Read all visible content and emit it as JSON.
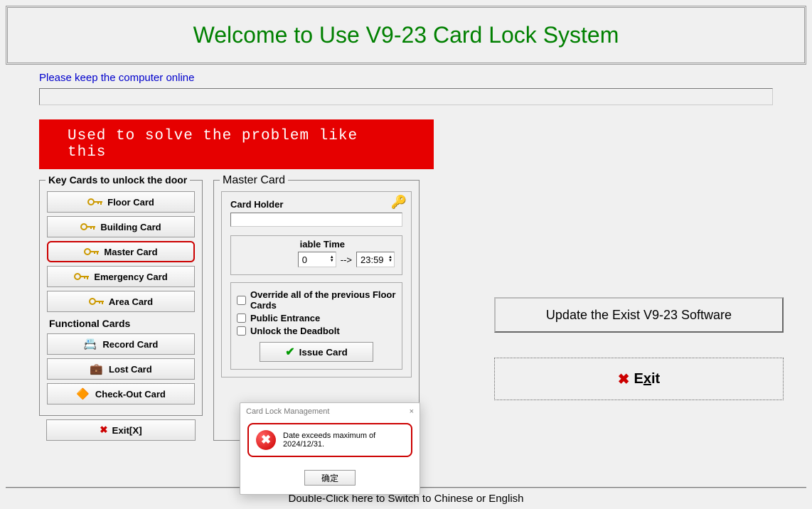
{
  "header": {
    "title": "Welcome to Use V9-23 Card Lock System"
  },
  "notice": "Please keep the computer online",
  "banner": "Used to solve the problem like this",
  "keyCardsSection": {
    "label": "Key Cards to unlock the door",
    "items": [
      {
        "label": "Floor Card"
      },
      {
        "label": "Building Card"
      },
      {
        "label": "Master Card"
      },
      {
        "label": "Emergency Card"
      },
      {
        "label": "Area Card"
      }
    ]
  },
  "functionalSection": {
    "label": "Functional Cards",
    "items": [
      {
        "label": "Record Card"
      },
      {
        "label": "Lost Card"
      },
      {
        "label": "Check-Out Card"
      }
    ]
  },
  "exitSmall": "Exit[X]",
  "masterCard": {
    "label": "Master Card",
    "holderLabel": "Card Holder",
    "timeLabel": "iable Time",
    "time1": "0",
    "arrow": "-->",
    "time2": "23:59",
    "options": [
      "Override all of the previous Floor Cards",
      "Public Entrance",
      "Unlock the Deadbolt"
    ],
    "issue": "Issue Card"
  },
  "modal": {
    "title": "Card Lock Management",
    "message": "Date exceeds maximum of 2024/12/31.",
    "ok": "确定"
  },
  "rightButtons": {
    "update": "Update the Exist V9-23 Software",
    "exitPrefix": "E",
    "exitUnderline": "x",
    "exitSuffix": "it"
  },
  "footer": "Double-Click here to Switch to Chinese or English"
}
